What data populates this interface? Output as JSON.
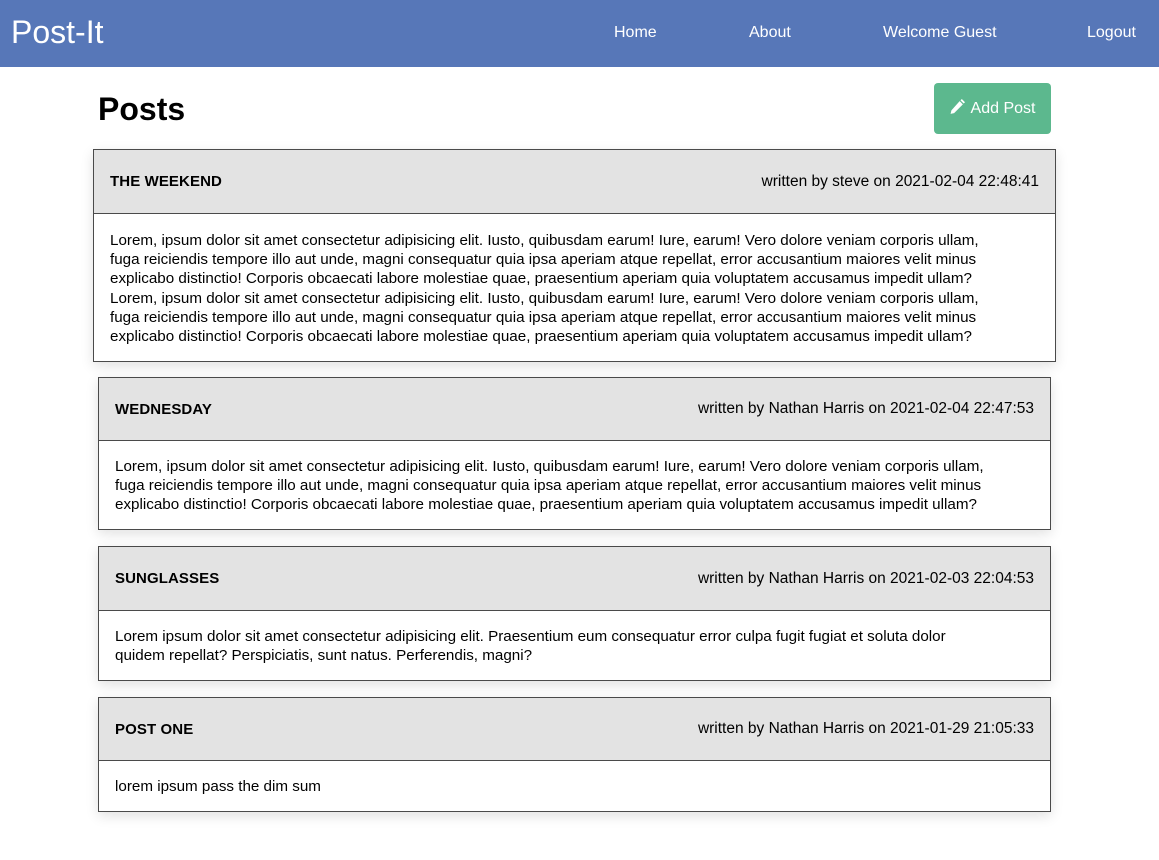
{
  "navbar": {
    "brand": "Post-It",
    "links": [
      "Home",
      "About",
      "Welcome Guest",
      "Logout"
    ]
  },
  "page": {
    "title": "Posts",
    "add_button": "Add Post",
    "add_icon": "pencil-icon"
  },
  "colors": {
    "navbar": "#5777b8",
    "add_button": "#5cb88e",
    "card_header": "#e3e3e3"
  },
  "posts": [
    {
      "title": "THE WEEKEND",
      "meta": "written by steve on 2021-02-04 22:48:41",
      "body_lines": [
        "Lorem, ipsum dolor sit amet consectetur adipisicing elit. Iusto, quibusdam earum! Iure, earum! Vero dolore veniam corporis ullam,",
        "fuga reiciendis tempore illo aut unde, magni consequatur quia ipsa aperiam atque repellat, error accusantium maiores velit minus",
        "explicabo distinctio! Corporis obcaecati labore molestiae quae, praesentium aperiam quia voluptatem accusamus impedit ullam?",
        "Lorem, ipsum dolor sit amet consectetur adipisicing elit. Iusto, quibusdam earum! Iure, earum! Vero dolore veniam corporis ullam,",
        "fuga reiciendis tempore illo aut unde, magni consequatur quia ipsa aperiam atque repellat, error accusantium maiores velit minus",
        "explicabo distinctio! Corporis obcaecati labore molestiae quae, praesentium aperiam quia voluptatem accusamus impedit ullam?"
      ]
    },
    {
      "title": "WEDNESDAY",
      "meta": "written by Nathan Harris on 2021-02-04 22:47:53",
      "body_lines": [
        "Lorem, ipsum dolor sit amet consectetur adipisicing elit. Iusto, quibusdam earum! Iure, earum! Vero dolore veniam corporis ullam,",
        "fuga reiciendis tempore illo aut unde, magni consequatur quia ipsa aperiam atque repellat, error accusantium maiores velit minus",
        "explicabo distinctio! Corporis obcaecati labore molestiae quae, praesentium aperiam quia voluptatem accusamus impedit ullam?"
      ]
    },
    {
      "title": "SUNGLASSES",
      "meta": "written by Nathan Harris on 2021-02-03 22:04:53",
      "body_lines": [
        "Lorem ipsum dolor sit amet consectetur adipisicing elit. Praesentium eum consequatur error culpa fugit fugiat et soluta dolor",
        "quidem repellat? Perspiciatis, sunt natus. Perferendis, magni?"
      ]
    },
    {
      "title": "POST ONE",
      "meta": "written by Nathan Harris on 2021-01-29 21:05:33",
      "body_lines": [
        "lorem ipsum pass the dim sum"
      ]
    }
  ]
}
